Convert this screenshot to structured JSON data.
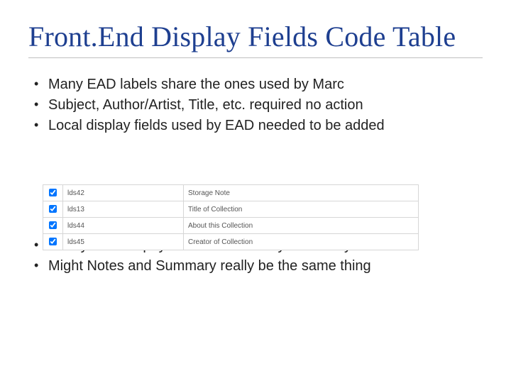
{
  "title": "Front.End Display Fields Code Table",
  "bullets_top": [
    "Many EAD labels share the ones used by Marc",
    "Subject, Author/Artist, Title, etc. required no action",
    "Local display fields used by EAD needed to be added"
  ],
  "table_rows": [
    {
      "checked": true,
      "code": "lds42",
      "label": "Storage Note"
    },
    {
      "checked": true,
      "code": "lds13",
      "label": "Title of Collection"
    },
    {
      "checked": true,
      "code": "lds44",
      "label": "About this Collection"
    },
    {
      "checked": true,
      "code": "lds45",
      "label": "Creator of Collection"
    }
  ],
  "bullets_bottom": [
    "Really need to pay attention to what you already have",
    "Might Notes and Summary really be the same thing"
  ]
}
